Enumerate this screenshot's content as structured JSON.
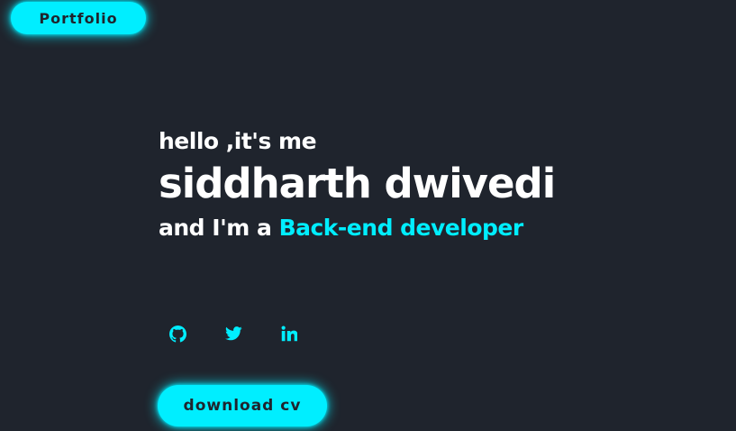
{
  "header": {
    "logo_label": "Portfolio"
  },
  "hero": {
    "greeting": "hello ,it's me",
    "name": "siddharth dwivedi",
    "role_prefix": "and I'm a ",
    "role_highlight": "Back-end developer"
  },
  "socials": [
    {
      "icon": "github-icon"
    },
    {
      "icon": "twitter-icon"
    },
    {
      "icon": "linkedin-icon"
    }
  ],
  "actions": {
    "download_label": "download cv"
  },
  "colors": {
    "background": "#1f242d",
    "accent": "#00eeff",
    "text": "#ffffff"
  }
}
